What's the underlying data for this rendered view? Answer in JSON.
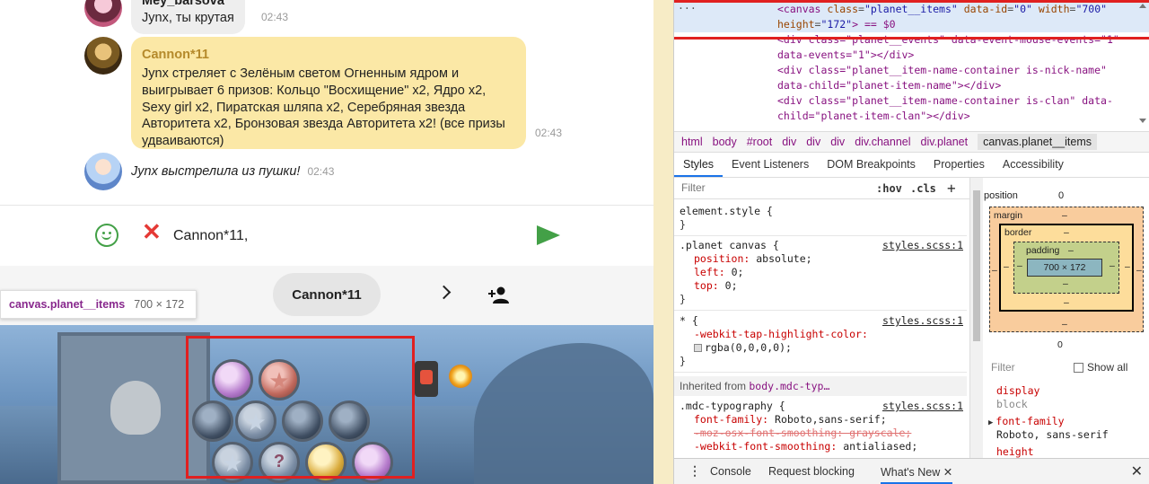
{
  "chat": {
    "messages": [
      {
        "author": "Mey_barsova",
        "text": "Jynx, ты крутая",
        "time": "02:43"
      },
      {
        "author": "Cannon*11",
        "text": "Jynx стреляет с Зелёным светом Огненным ядром и выигрывает 6 призов: Кольцо \"Восхищение\" x2, Ядро x2, Sexy girl x2, Пиратская шляпа x2, Серебряная звезда Авторитета x2, Бронзовая звезда Авторитета x2! (все призы удваиваются)",
        "time": "02:43"
      },
      {
        "author": "",
        "text": "Jynx выстрелила из пушки!",
        "time": "02:43"
      }
    ],
    "composer": {
      "value": "Cannon*11,"
    }
  },
  "game": {
    "nick": "Cannon*11"
  },
  "tooltip": {
    "selector": "canvas.planet__items",
    "size": "700 × 172"
  },
  "devtools": {
    "elements": {
      "line1_tag": "<canvas ",
      "line1_attr1": "class",
      "line1_val1": "\"planet__items\"",
      "line1_attr2": "data-id",
      "line1_val2": "\"0\"",
      "line1_attr3": "width",
      "line1_val3": "\"700\"",
      "line2_attr": "height",
      "line2_val": "\"172\"",
      "line2_tail": "> == $0",
      "line3": "<div class=\"planet__events\" data-event-mouse-events=\"1\"",
      "line4": "data-events=\"1\"></div>",
      "line5": "<div class=\"planet__item-name-container is-nick-name\"",
      "line6": "data-child=\"planet-item-name\"></div>",
      "line7": "<div class=\"planet__item-name-container is-clan\" data-",
      "line8": "child=\"planet-item-clan\"></div>"
    },
    "breadcrumbs": [
      "html",
      "body",
      "#root",
      "div",
      "div",
      "div",
      "div.channel",
      "div.planet",
      "canvas.planet__items"
    ],
    "tabs": [
      "Styles",
      "Event Listeners",
      "DOM Breakpoints",
      "Properties",
      "Accessibility"
    ],
    "styles": {
      "filter_placeholder": "Filter",
      "hov": ":hov",
      "cls": ".cls",
      "element_style": "element.style {",
      "close_brace": "}",
      "rule1_selector": ".planet canvas {",
      "rule1_source": "styles.scss:1",
      "rule1_props": [
        {
          "name": "position",
          "value": "absolute;"
        },
        {
          "name": "left",
          "value": "0;"
        },
        {
          "name": "top",
          "value": "0;"
        }
      ],
      "rule2_selector": "* {",
      "rule2_source": "styles.scss:1",
      "rule2_prop_name": "-webkit-tap-highlight-color",
      "rule2_prop_value": "rgba(0,0,0,0);",
      "inherited_label": "Inherited from ",
      "inherited_from": "body.mdc-typ…",
      "rule3_selector": ".mdc-typography {",
      "rule3_source": "styles.scss:1",
      "rule3_props": [
        {
          "name": "font-family",
          "value": "Roboto,sans-serif;"
        },
        {
          "name": "-moz-osx-font-smoothing",
          "value": "grayscale;"
        },
        {
          "name": "-webkit-font-smoothing",
          "value": "antialiased;"
        }
      ]
    },
    "computed": {
      "position_label": "position",
      "position_value": "0",
      "margin_label": "margin",
      "border_label": "border",
      "padding_label": "padding",
      "dash": "–",
      "content_size": "700 × 172",
      "bottom_value": "0",
      "filter_placeholder": "Filter",
      "show_all": "Show all",
      "props": [
        {
          "name": "display",
          "style": "pink"
        },
        {
          "name": "block",
          "style": "dim"
        },
        {
          "name": "font-family",
          "style": "pink"
        },
        {
          "name": "Roboto, sans-serif",
          "style": "dark"
        },
        {
          "name": "height",
          "style": "pink"
        }
      ]
    },
    "drawer": {
      "tabs": [
        "Console",
        "Request blocking",
        "What's New"
      ],
      "active": "What's New"
    }
  }
}
